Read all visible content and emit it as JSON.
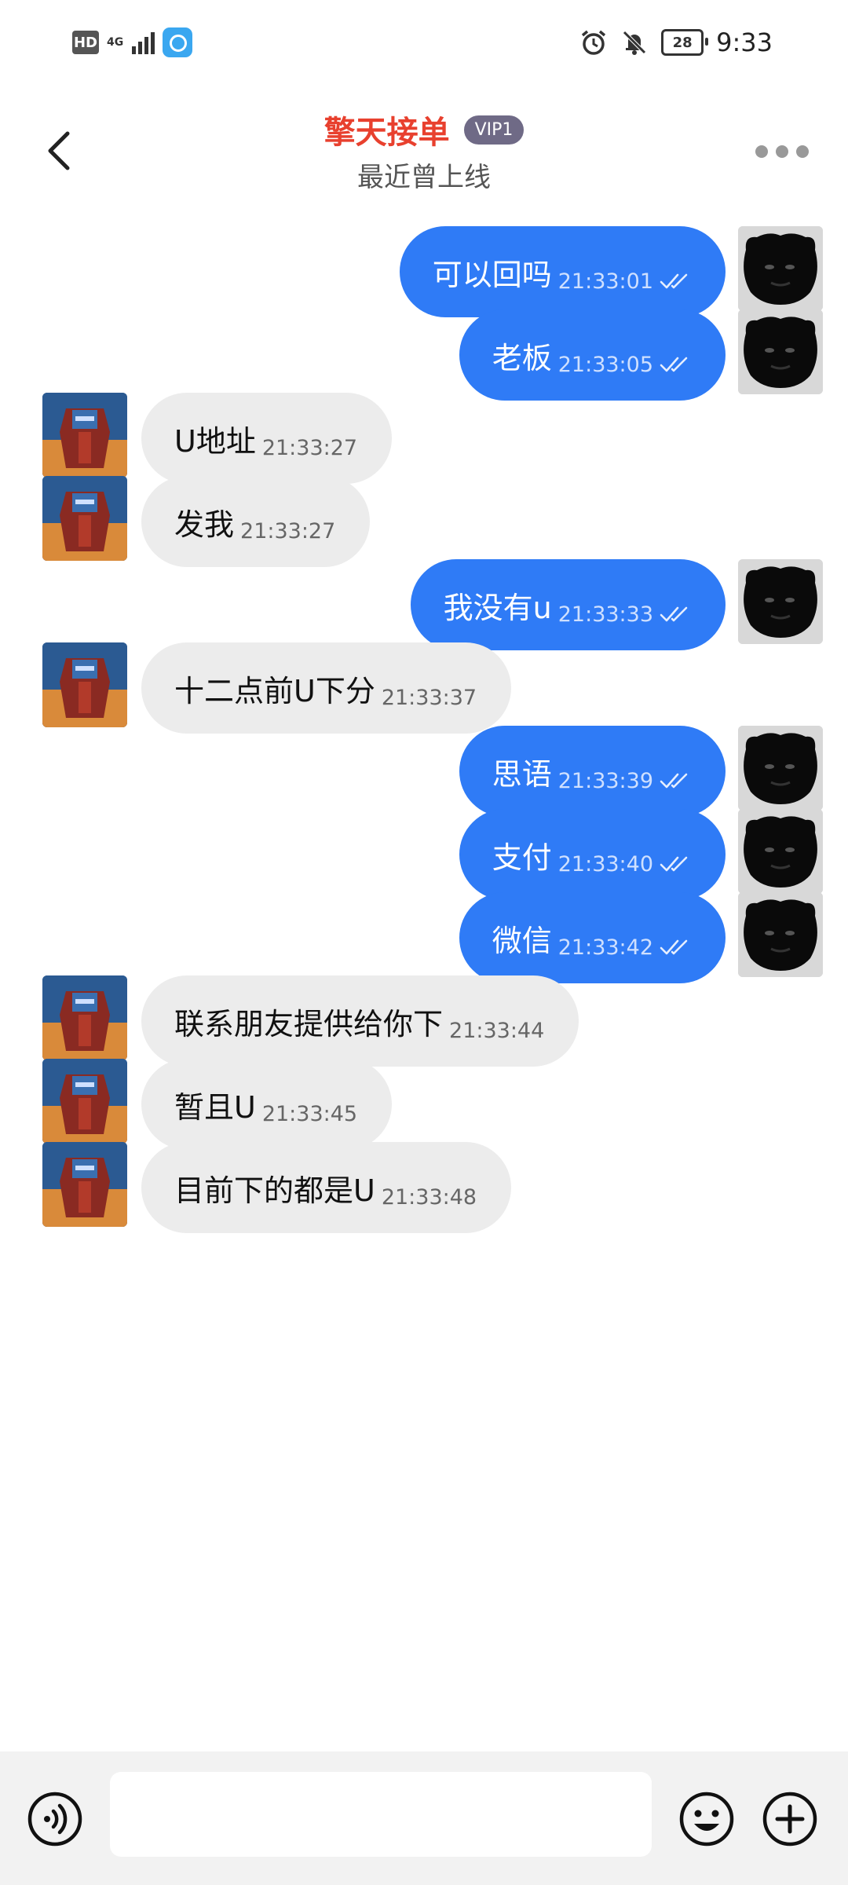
{
  "status_bar": {
    "hd": "HD",
    "network": "4G",
    "battery": "28",
    "time": "9:33"
  },
  "header": {
    "title": "擎天接单",
    "badge": "VIP1",
    "subtitle": "最近曾上线"
  },
  "messages": [
    {
      "direction": "out",
      "text": "可以回吗",
      "time": "21:33:01",
      "read": true
    },
    {
      "direction": "out",
      "text": "老板",
      "time": "21:33:05",
      "read": true
    },
    {
      "direction": "in",
      "text": "U地址",
      "time": "21:33:27"
    },
    {
      "direction": "in",
      "text": "发我",
      "time": "21:33:27"
    },
    {
      "direction": "out",
      "text": "我没有u",
      "time": "21:33:33",
      "read": true
    },
    {
      "direction": "in",
      "text": "十二点前U下分",
      "time": "21:33:37"
    },
    {
      "direction": "out",
      "text": "思语",
      "time": "21:33:39",
      "read": true
    },
    {
      "direction": "out",
      "text": "支付",
      "time": "21:33:40",
      "read": true
    },
    {
      "direction": "out",
      "text": "微信",
      "time": "21:33:42",
      "read": true
    },
    {
      "direction": "in",
      "text": "联系朋友提供给你下",
      "time": "21:33:44"
    },
    {
      "direction": "in",
      "text": "暂且U",
      "time": "21:33:45"
    },
    {
      "direction": "in",
      "text": "目前下的都是U",
      "time": "21:33:48"
    }
  ],
  "input": {
    "value": "",
    "placeholder": ""
  },
  "colors": {
    "accent_title": "#e8402e",
    "outgoing_bubble": "#2f7bf6",
    "incoming_bubble": "#ececec",
    "vip_badge": "#6f6a86"
  },
  "icons": {
    "back": "chevron-left-icon",
    "more": "more-dots-icon",
    "voice": "voice-icon",
    "emoji": "emoji-icon",
    "plus": "plus-icon",
    "read": "double-check-icon"
  }
}
